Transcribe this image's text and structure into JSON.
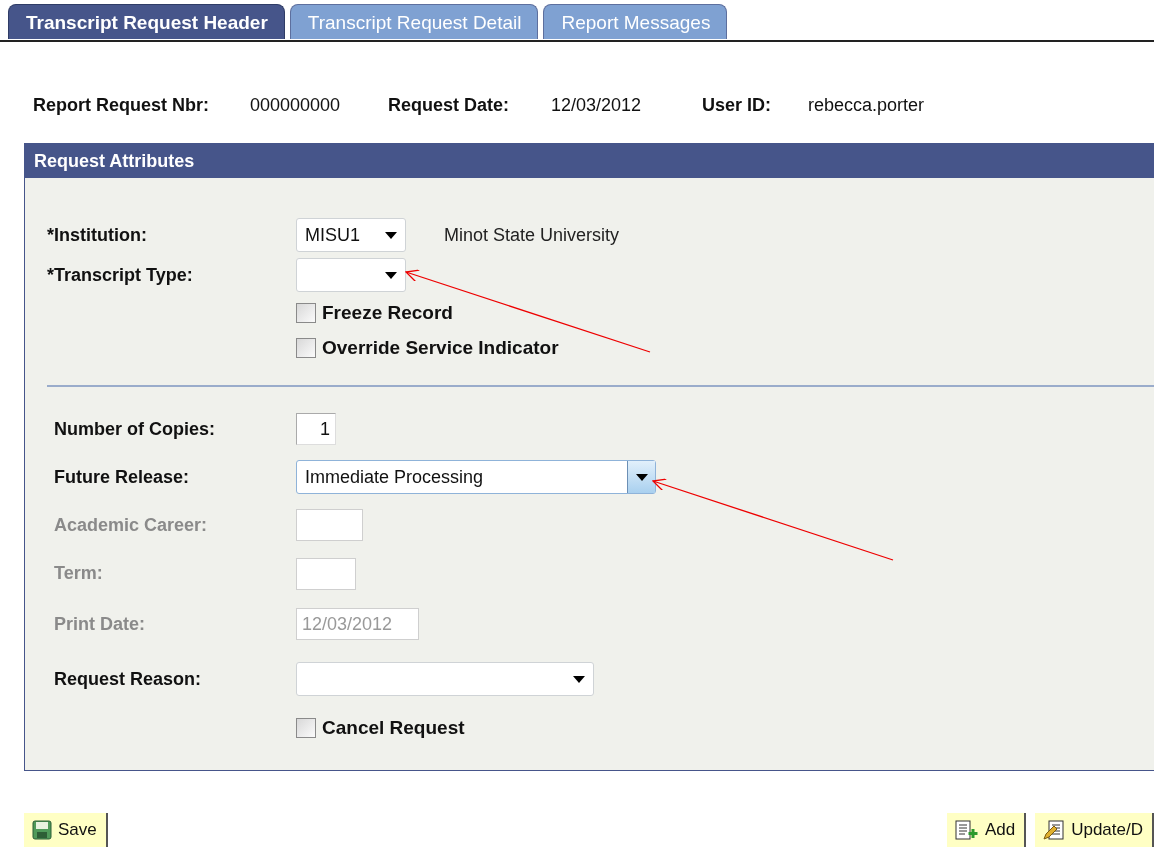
{
  "tabs": [
    {
      "label": "Transcript Request Header",
      "selected": true
    },
    {
      "label": "Transcript Request Detail",
      "selected": false
    },
    {
      "label": "Report Messages",
      "selected": false
    }
  ],
  "header_fields": [
    {
      "label": "Report Request Nbr:",
      "value": "000000000"
    },
    {
      "label": "Request Date:",
      "value": "12/03/2012"
    },
    {
      "label": "User ID:",
      "value": "rebecca.porter"
    }
  ],
  "request_attributes": {
    "title": "Request Attributes",
    "sections": [
      [
        {
          "kind": "select",
          "label": "*Institution:",
          "value": "MISU1",
          "description": "Minot State University",
          "focused": false
        },
        {
          "kind": "select",
          "label": "*Transcript Type:",
          "focused": false
        },
        {
          "kind": "checkbox",
          "label": "Freeze Record",
          "checked": false
        },
        {
          "kind": "checkbox",
          "label": "Override Service Indicator",
          "checked": false
        }
      ],
      [
        {
          "kind": "number",
          "label": "Number of Copies:",
          "value": "1",
          "disabled": false
        },
        {
          "kind": "select",
          "label": "Future Release:",
          "value": "Immediate Processing",
          "focused": true
        },
        {
          "kind": "text",
          "label": "Academic Career:",
          "disabled": true
        },
        {
          "kind": "text",
          "label": "Term:",
          "disabled": true
        },
        {
          "kind": "text",
          "label": "Print Date:",
          "value": "12/03/2012",
          "disabled": true
        },
        {
          "kind": "select",
          "label": "Request Reason:",
          "focused": false
        },
        {
          "kind": "checkbox",
          "label": "Cancel Request",
          "checked": false
        }
      ]
    ]
  },
  "toolbar": {
    "left": [
      {
        "kind": "save",
        "label": "Save"
      }
    ],
    "right": [
      {
        "kind": "add",
        "label": "Add"
      },
      {
        "kind": "update",
        "label": "Update/D"
      }
    ]
  }
}
